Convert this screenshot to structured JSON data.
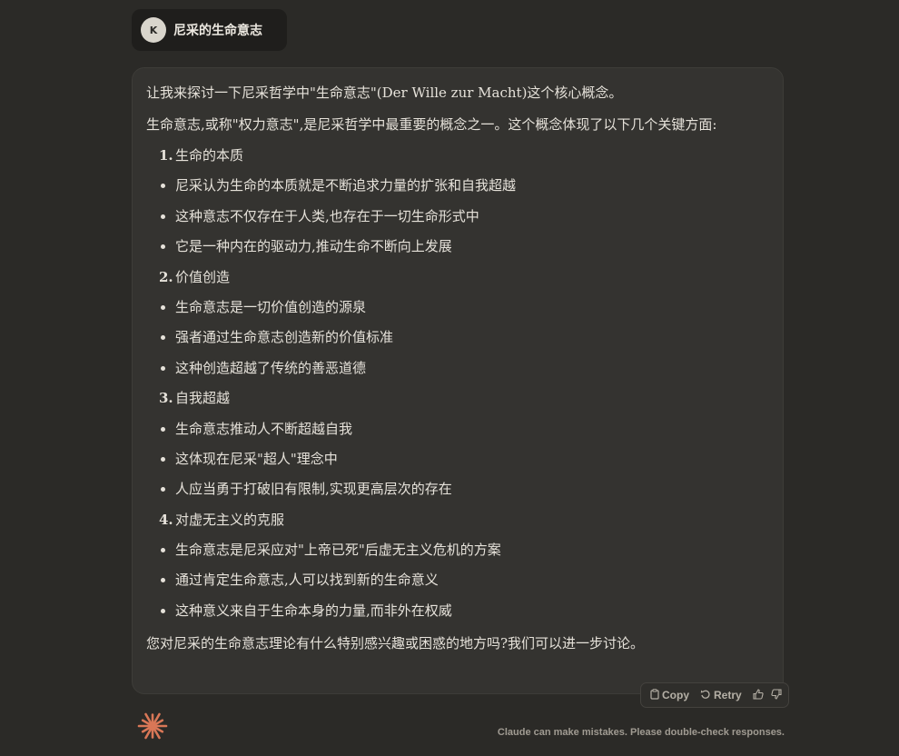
{
  "user_message": {
    "avatar_initial": "K",
    "text": "尼采的生命意志"
  },
  "response": {
    "intro": "让我来探讨一下尼采哲学中\"生命意志\"(Der Wille zur Macht)这个核心概念。",
    "lead": "生命意志,或称\"权力意志\",是尼采哲学中最重要的概念之一。这个概念体现了以下几个关键方面:",
    "items": [
      {
        "type": "num",
        "num": "1.",
        "text": "生命的本质"
      },
      {
        "type": "bullet",
        "text": "尼采认为生命的本质就是不断追求力量的扩张和自我超越"
      },
      {
        "type": "bullet",
        "text": "这种意志不仅存在于人类,也存在于一切生命形式中"
      },
      {
        "type": "bullet",
        "text": "它是一种内在的驱动力,推动生命不断向上发展"
      },
      {
        "type": "num",
        "num": "2.",
        "text": "价值创造"
      },
      {
        "type": "bullet",
        "text": "生命意志是一切价值创造的源泉"
      },
      {
        "type": "bullet",
        "text": "强者通过生命意志创造新的价值标准"
      },
      {
        "type": "bullet",
        "text": "这种创造超越了传统的善恶道德"
      },
      {
        "type": "num",
        "num": "3.",
        "text": "自我超越"
      },
      {
        "type": "bullet",
        "text": "生命意志推动人不断超越自我"
      },
      {
        "type": "bullet",
        "text": "这体现在尼采\"超人\"理念中"
      },
      {
        "type": "bullet",
        "text": "人应当勇于打破旧有限制,实现更高层次的存在"
      },
      {
        "type": "num",
        "num": "4.",
        "text": "对虚无主义的克服"
      },
      {
        "type": "bullet",
        "text": "生命意志是尼采应对\"上帝已死\"后虚无主义危机的方案"
      },
      {
        "type": "bullet",
        "text": "通过肯定生命意志,人可以找到新的生命意义"
      },
      {
        "type": "bullet",
        "text": "这种意义来自于生命本身的力量,而非外在权威"
      }
    ],
    "closing": "您对尼采的生命意志理论有什么特别感兴趣或困惑的地方吗?我们可以进一步讨论。"
  },
  "actions": {
    "copy_label": "Copy",
    "retry_label": "Retry",
    "copy_icon": "clipboard-icon",
    "retry_icon": "retry-icon",
    "thumbs_up_icon": "thumbs-up-icon",
    "thumbs_down_icon": "thumbs-down-icon"
  },
  "footer": {
    "disclaimer": "Claude can make mistakes. Please double-check responses.",
    "logo_color": "#d97757"
  }
}
